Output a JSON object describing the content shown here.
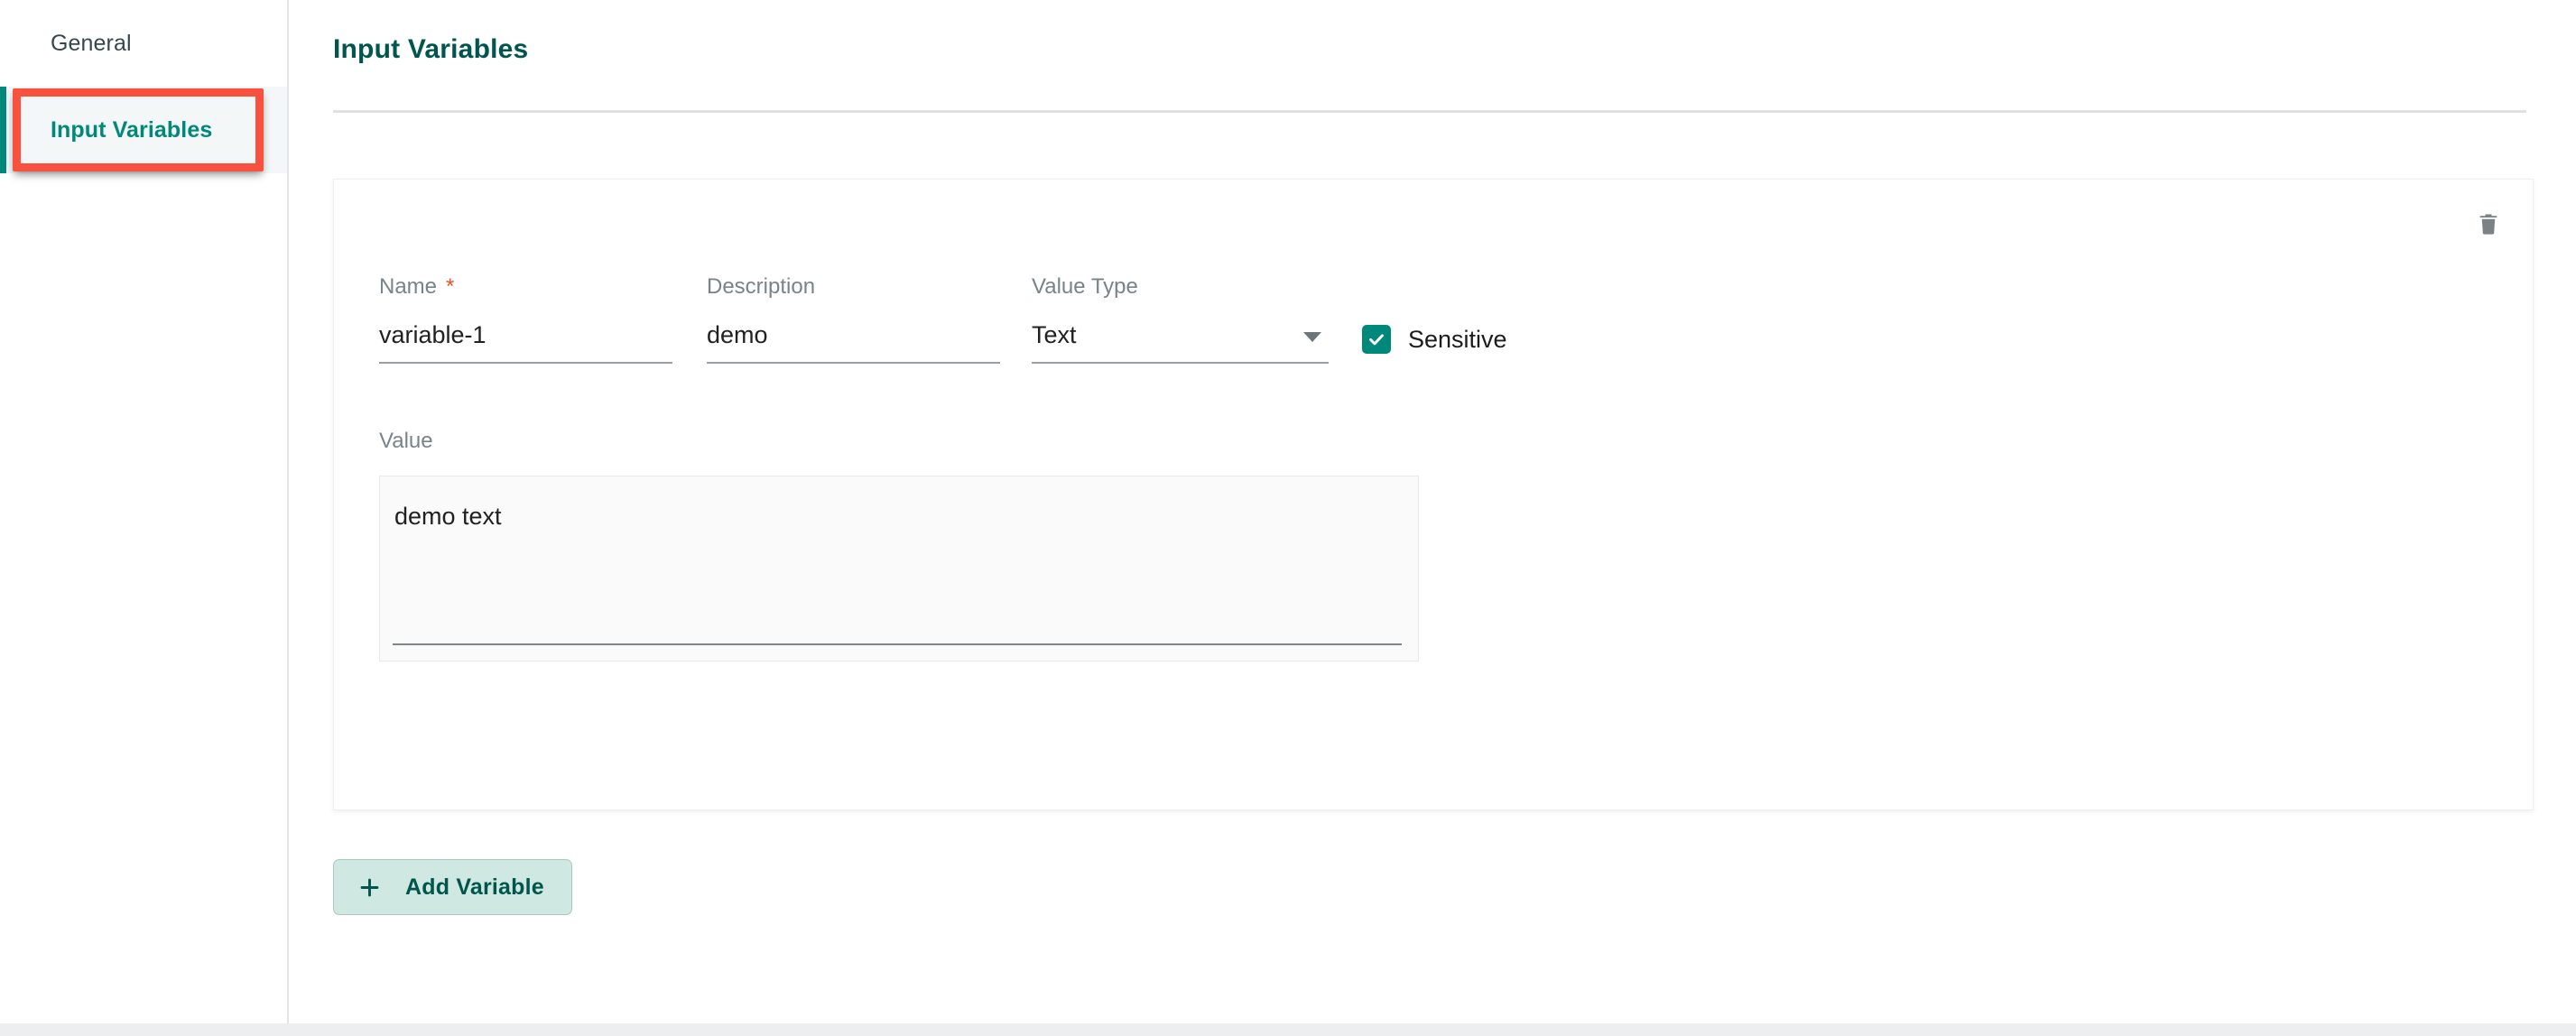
{
  "sidebar": {
    "items": [
      {
        "label": "General",
        "active": false,
        "name": "general"
      },
      {
        "label": "Input Variables",
        "active": true,
        "name": "input-variables"
      }
    ]
  },
  "main": {
    "title": "Input Variables",
    "card": {
      "delete_icon": "trash-icon",
      "fields": {
        "name": {
          "label": "Name",
          "required_marker": "*",
          "value": "variable-1",
          "placeholder": ""
        },
        "description": {
          "label": "Description",
          "value": "demo",
          "placeholder": ""
        },
        "value_type": {
          "label": "Value Type",
          "value": "Text",
          "options": [
            "Text"
          ],
          "dropdown_icon": "chevron-down-icon"
        },
        "sensitive": {
          "label": "Sensitive",
          "checked": true,
          "check_icon": "check-icon"
        },
        "value": {
          "label": "Value",
          "value": "demo text",
          "placeholder": ""
        }
      }
    },
    "add_button": {
      "label": "Add Variable",
      "icon": "plus-icon"
    }
  },
  "annotation": {
    "highlight_color": "#f9513e",
    "target": "input-variables"
  },
  "theme": {
    "accent": "#00897b",
    "title_color": "#00564d",
    "required_star": "#f4511e",
    "add_button_bg": "#cfe9e2",
    "active_nav_bg": "#f3f7f7"
  }
}
